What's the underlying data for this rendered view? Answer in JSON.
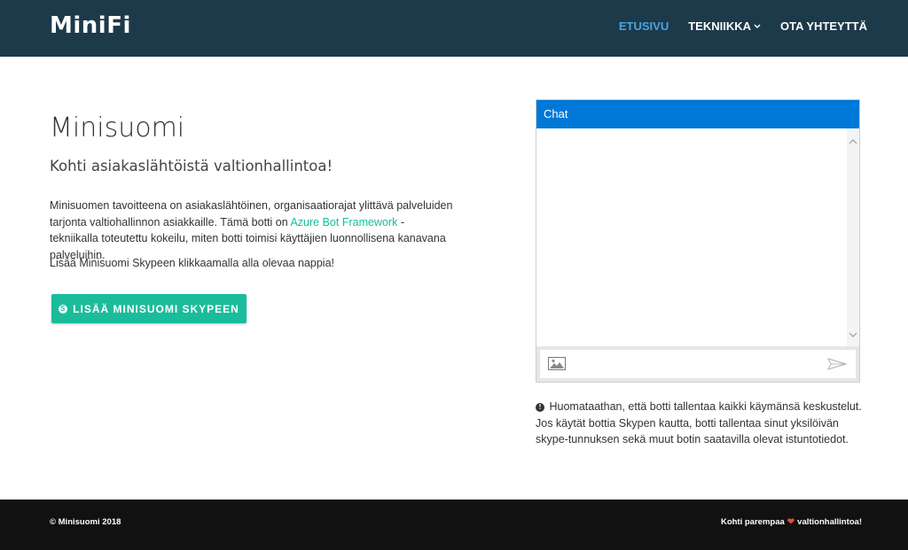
{
  "header": {
    "brand": "MiniFi",
    "nav": [
      {
        "label": "ETUSIVU",
        "active": true
      },
      {
        "label": "TEKNIIKKA",
        "has_dropdown": true
      },
      {
        "label": "OTA YHTEYTTÄ"
      }
    ]
  },
  "main": {
    "title": "Minisuomi",
    "subtitle": "Kohti asiakaslähtöistä valtionhallintoa!",
    "intro_before_link": "Minisuomen tavoitteena on asiakaslähtöinen, organisaatiorajat ylittävä palveluiden tarjonta valtiohallinnon asiakkaille. Tämä botti on ",
    "intro_link": "Azure Bot Framework",
    "intro_after_link": " - tekniikalla toteutettu kokeilu, miten botti toimisi käyttäjien luonnollisena kanavana palveluihin.",
    "cta_text": "Lisää Minisuomi Skypeen klikkaamalla alla olevaa nappia!",
    "skype_button_label": "LISÄÄ MINISUOMI SKYPEEN"
  },
  "chat": {
    "header": "Chat",
    "input_value": "",
    "notice": "Huomataathan, että botti tallentaa kaikki käymänsä keskustelut. Jos käytät bottia Skypen kautta, botti tallentaa sinut yksilöivän skype-tunnuksen sekä muut botin saatavilla olevat istuntotiedot."
  },
  "footer": {
    "copyright": "© Minisuomi 2018",
    "slogan_before": "Kohti parempaa",
    "slogan_after": "valtionhallintoa!"
  },
  "colors": {
    "navbar": "#1d3a4a",
    "nav_active": "#4aa3df",
    "accent": "#1abc9c",
    "chat_header": "#0078d7",
    "footer": "#111111",
    "heart": "#e74c3c"
  },
  "icons": [
    "skype-icon",
    "image-upload-icon",
    "send-icon",
    "info-icon",
    "heart-icon",
    "chevron-down-icon"
  ]
}
